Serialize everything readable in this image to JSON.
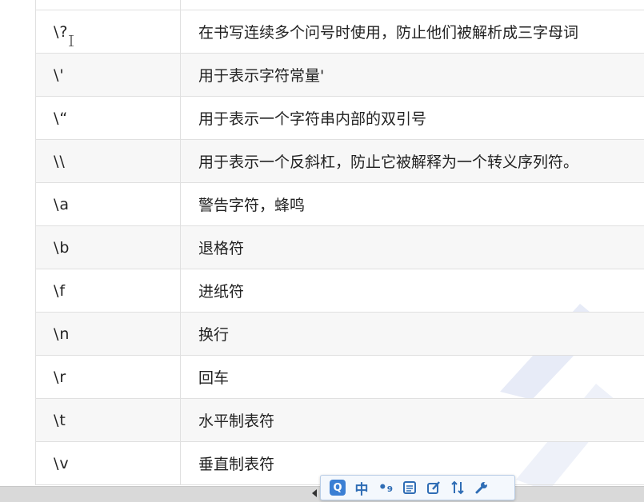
{
  "escape_table": {
    "rows": [
      {
        "code": "",
        "description": ""
      },
      {
        "code": "\\?",
        "description": "在书写连续多个问号时使用，防止他们被解析成三字母词"
      },
      {
        "code": "\\'",
        "description": "用于表示字符常量'"
      },
      {
        "code": "\\“",
        "description": "用于表示一个字符串内部的双引号"
      },
      {
        "code": "\\\\",
        "description": "用于表示一个反斜杠，防止它被解释为一个转义序列符。"
      },
      {
        "code": "\\a",
        "description": "警告字符，蜂鸣"
      },
      {
        "code": "\\b",
        "description": "退格符"
      },
      {
        "code": "\\f",
        "description": "进纸符"
      },
      {
        "code": "\\n",
        "description": "换行"
      },
      {
        "code": "\\r",
        "description": "回车"
      },
      {
        "code": "\\t",
        "description": "水平制表符"
      },
      {
        "code": "\\v",
        "description": "垂直制表符"
      }
    ]
  },
  "ime_toolbar": {
    "logo_label": "Q",
    "language_label": "中",
    "punctuation_label": "•₉",
    "icons": [
      "ime-logo-icon",
      "chinese-mode-icon",
      "punctuation-icon",
      "keyboard-icon",
      "skin-icon",
      "tools-icon",
      "wrench-icon"
    ]
  },
  "colors": {
    "border": "#e0e0e0",
    "alt_row": "#f7f7f7",
    "ime_blue": "#2f6db5",
    "watermark": "#e7ebf7"
  }
}
